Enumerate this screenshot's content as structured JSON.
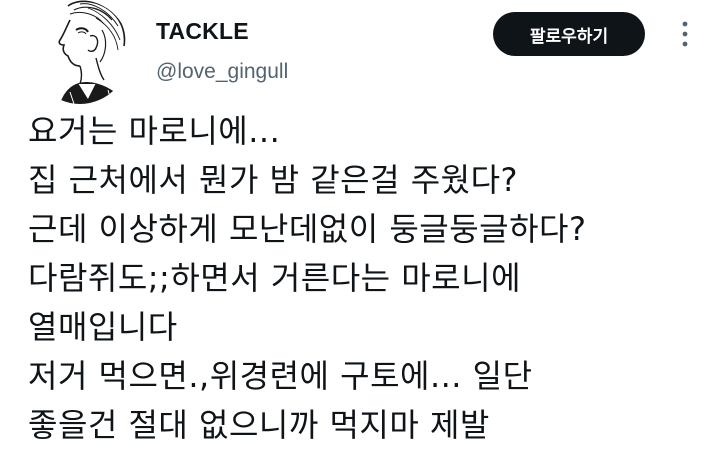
{
  "user": {
    "display_name": "TACKLE",
    "handle": "@love_gingull",
    "avatar_icon": "manga-portrait-avatar"
  },
  "actions": {
    "follow_label": "팔로우하기",
    "more_icon": "more-vertical-icon"
  },
  "tweet": {
    "lines": [
      "요거는 마로니에...",
      "집 근처에서 뭔가 밤 같은걸 주웠다?",
      "근데 이상하게 모난데없이 둥글둥글하다?",
      "다람쥐도;;하면서 거른다는 마로니에",
      "열매입니다",
      "저거 먹으면.,위경련에 구토에... 일단",
      "좋을건 절대 없으니까 먹지마 제발"
    ]
  },
  "colors": {
    "text": "#0f1419",
    "secondary_text": "#536471",
    "button_bg": "#0f1419",
    "button_text": "#ffffff"
  }
}
